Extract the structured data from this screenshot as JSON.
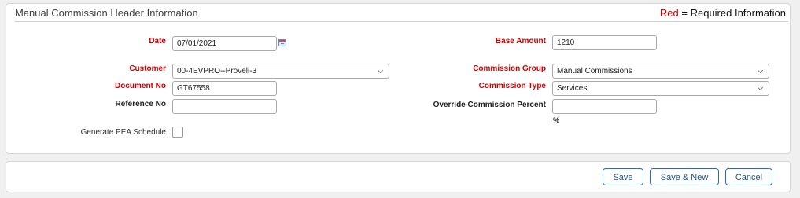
{
  "header": {
    "title": "Manual Commission Header Information",
    "legend_red": "Red",
    "legend_rest": "= Required Information"
  },
  "fields": {
    "date": {
      "label": "Date",
      "value": "07/01/2021"
    },
    "base_amount": {
      "label": "Base Amount",
      "value": "1210"
    },
    "customer": {
      "label": "Customer",
      "value": "00-4EVPRO--Proveli-3"
    },
    "commission_group": {
      "label": "Commission Group",
      "value": "Manual Commissions"
    },
    "document_no": {
      "label": "Document No",
      "value": "GT67558"
    },
    "commission_type": {
      "label": "Commission Type",
      "value": "Services"
    },
    "reference_no": {
      "label": "Reference No",
      "value": ""
    },
    "override_percent": {
      "label": "Override Commission Percent",
      "value": "",
      "unit": "%"
    },
    "generate_pea": {
      "label": "Generate PEA Schedule",
      "checked": false
    }
  },
  "buttons": {
    "save": "Save",
    "save_new": "Save & New",
    "cancel": "Cancel"
  },
  "colors": {
    "required": "#cc0000",
    "button": "#2b6cb0"
  },
  "icons": {
    "date_picker": "calendar-icon",
    "dropdown": "chevron-down-icon"
  }
}
